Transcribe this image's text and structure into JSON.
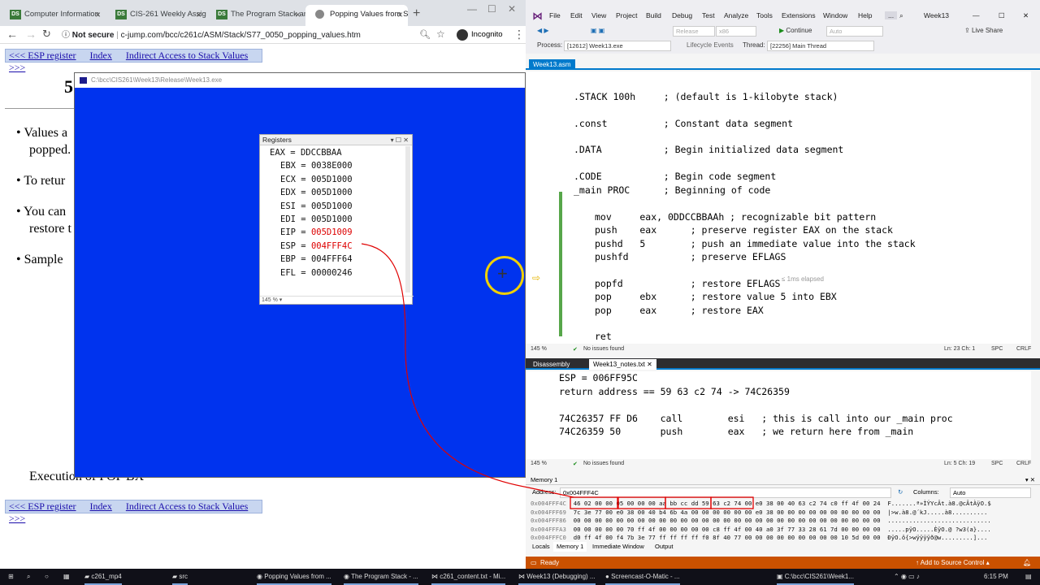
{
  "browser": {
    "tabs": [
      {
        "label": "Computer Information",
        "fav": "DS"
      },
      {
        "label": "CIS-261 Weekly Assign",
        "fav": "DS"
      },
      {
        "label": "The Program Stack an",
        "fav": "DS"
      },
      {
        "label": "Popping Values from S",
        "fav": "circle"
      }
    ],
    "url_prefix": "Not secure",
    "url": "c-jump.com/bcc/c261c/ASM/Stack/S77_0050_popping_values.htm",
    "incognito": "Incognito"
  },
  "page": {
    "nav_prev": "<<< ESP register",
    "nav_index": "Index",
    "nav_next": "Indirect Access to Stack Values >>>",
    "title_fragment": "5",
    "bullets": [
      "Values a",
      "popped.",
      "To retur",
      "You can",
      "restore t",
      "Sample"
    ],
    "exec_text": "Execution of POP BX"
  },
  "console": {
    "caption": "C:\\bcc\\CIS261\\Week13\\Release\\Week13.exe"
  },
  "registers": {
    "title": "Registers",
    "zoom": "145 %",
    "rows": [
      {
        "name": "EAX",
        "value": "DDCCBBAA",
        "changed": false,
        "indent": false
      },
      {
        "name": "EBX",
        "value": "0038E000",
        "changed": false,
        "indent": true
      },
      {
        "name": "ECX",
        "value": "005D1000",
        "changed": false,
        "indent": true
      },
      {
        "name": "EDX",
        "value": "005D1000",
        "changed": false,
        "indent": true
      },
      {
        "name": "ESI",
        "value": "005D1000",
        "changed": false,
        "indent": true
      },
      {
        "name": "EDI",
        "value": "005D1000",
        "changed": false,
        "indent": true
      },
      {
        "name": "EIP",
        "value": "005D1009",
        "changed": true,
        "indent": true
      },
      {
        "name": "ESP",
        "value": "004FFF4C",
        "changed": true,
        "indent": true
      },
      {
        "name": "EBP",
        "value": "004FFF64",
        "changed": false,
        "indent": true
      },
      {
        "name": "EFL",
        "value": "00000246",
        "changed": false,
        "indent": true
      }
    ]
  },
  "vs": {
    "menu": [
      "File",
      "Edit",
      "View",
      "Project",
      "Build",
      "Debug",
      "Test",
      "Analyze",
      "Tools",
      "Extensions",
      "Window",
      "Help"
    ],
    "search_label": "...",
    "solution": "Week13",
    "config": "Release",
    "platform": "x86",
    "continue": "Continue",
    "auto": "Auto",
    "live_share": "Live Share",
    "process_label": "Process:",
    "process": "[12612] Week13.exe",
    "lifecycle": "Lifecycle Events",
    "thread_label": "Thread:",
    "thread": "[22256] Main Thread",
    "editor_tab": "Week13.asm",
    "editor_lines": [
      ".STACK 100h     ; (default is 1-kilobyte stack)",
      ".const          ; Constant data segment",
      ".DATA           ; Begin initialized data segment",
      ".CODE           ; Begin code segment",
      "_main PROC      ; Beginning of code",
      "mov     eax, 0DDCCBBAAh ; recognizable bit pattern",
      "push    eax      ; preserve register EAX on the stack",
      "pushd   5        ; push an immediate value into the stack",
      "pushfd           ; preserve EFLAGS",
      "popfd            ; restore EFLAGS",
      "pop     ebx      ; restore value 5 into EBX",
      "pop     eax      ; restore EAX",
      "ret"
    ],
    "elapsed": "≤ 1ms elapsed",
    "editor_zoom": "145 %",
    "no_issues": "No issues found",
    "editor_pos": "Ln: 23    Ch: 1",
    "spc": "SPC",
    "crlf": "CRLF",
    "doc_tabs": [
      "Disassembly",
      "Week13_notes.txt"
    ],
    "notes_lines": [
      "ESP = 006FF95C",
      "return address == 59 63 c2 74 -> 74C26359",
      "",
      "74C26357 FF D6    call        esi   ; this is call into our _main proc",
      "74C26359 50       push        eax   ; we return here from _main"
    ],
    "notes_zoom": "145 %",
    "notes_pos": "Ln: 5    Ch: 19",
    "memory_title": "Memory 1",
    "address_label": "Address:",
    "address": "0x004FFF4C",
    "columns_label": "Columns:",
    "columns": "Auto",
    "memory_rows": [
      {
        "addr": "0x004FFF4C",
        "bytes": "46 02 00 00 05 00 00 00 aa bb cc dd 59 63 c2 74 00 e0 38 00 40 63 c2 74 c0 ff 4f 00 24",
        "ascii": "F.......ª»ÌÝYcÂt.à8.@cÂtÀÿO.$"
      },
      {
        "addr": "0x004FFF69",
        "bytes": "7c 3e 77 00 e0 38 00 40 b4 6b 4a 00 00 00 00 00 00 e0 38 00 00 00 00 00 00 00 00 00 00",
        "ascii": "|>w.à8.@´kJ.....à8.........."
      },
      {
        "addr": "0x004FFF86",
        "bytes": "00 00 00 00 00 00 00 00 00 00 00 00 00 00 00 00 00 00 00 00 00 00 00 00 00 00 00 00 00",
        "ascii": "............................."
      },
      {
        "addr": "0x004FFFA3",
        "bytes": "00 00 00 00 00 70 ff 4f 00 00 00 00 00 c8 ff 4f 00 40 a0 3f 77 33 28 61 7d 00 00 00 00",
        "ascii": ".....pÿO.....ÈÿO.@ ?w3(a}...."
      },
      {
        "addr": "0x004FFFC0",
        "bytes": "d0 ff 4f 00 f4 7b 3e 77 ff ff ff ff f0 8f 40 77 00 00 00 00 00 00 00 00 00 10 5d 00 00",
        "ascii": "ÐÿO.ô{>wÿÿÿÿð@w.........]..."
      }
    ],
    "bottom_tabs": [
      "Locals",
      "Memory 1",
      "Immediate Window",
      "Output"
    ],
    "status_ready": "Ready",
    "status_source": "Add to Source Control"
  },
  "taskbar": {
    "items": [
      {
        "label": "c261_mp4",
        "icon": "folder"
      },
      {
        "label": "src",
        "icon": "folder"
      },
      {
        "label": "Popping Values from ...",
        "icon": "chrome"
      },
      {
        "label": "The Program Stack - ...",
        "icon": "chrome"
      },
      {
        "label": "c261_content.txt - Mi...",
        "icon": "vs"
      },
      {
        "label": "Week13 (Debugging) ...",
        "icon": "vs"
      },
      {
        "label": "Screencast-O-Matic - ...",
        "icon": "screencast"
      },
      {
        "label": "C:\\bcc\\CIS261\\Week1...",
        "icon": "console"
      }
    ],
    "time": "6:15 PM"
  },
  "colors": {
    "console_bg": "#0033ee",
    "vs_accent": "#007acc",
    "status_debug": "#ca5100",
    "annotation_red": "#e00000",
    "cursor_ring": "#f0d000"
  }
}
